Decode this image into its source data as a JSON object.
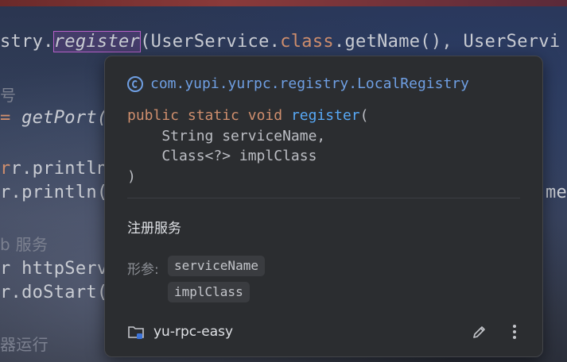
{
  "editor": {
    "line1_prefix": "stry.",
    "line1_method": "register",
    "line1_suffix": "(UserService.",
    "line1_class_kw": "class",
    "line1_rest": ".getName(), UserServi",
    "line2": "号",
    "line3_prefix": "= ",
    "line3_method": "getPort(",
    "line4": "r.println(",
    "line5": "r.println(",
    "line5_right": "me",
    "line6": "b 服务",
    "line7": "r httpServ",
    "line8": "r.doStart(",
    "line9": "器运行"
  },
  "popup": {
    "qualified_name": "com.yupi.yurpc.registry.LocalRegistry",
    "signature": {
      "public": "public",
      "static": "static",
      "void": "void",
      "method": "register",
      "open_paren": "(",
      "param1": "    String serviceName,",
      "param2": "    Class<?> implClass",
      "close_paren": ")"
    },
    "description": "注册服务",
    "params_label": "形参:",
    "params": [
      "serviceName",
      "implClass"
    ],
    "project": "yu-rpc-easy"
  },
  "icons": {
    "class": "class-c-icon",
    "folder": "module-folder-icon",
    "edit": "pencil-icon",
    "more": "more-vertical-icon"
  },
  "colors": {
    "popup_bg": "#2b2d30",
    "keyword": "#cf8e6d",
    "method": "#57a8f5",
    "qualified_name": "#6f9fe3"
  }
}
